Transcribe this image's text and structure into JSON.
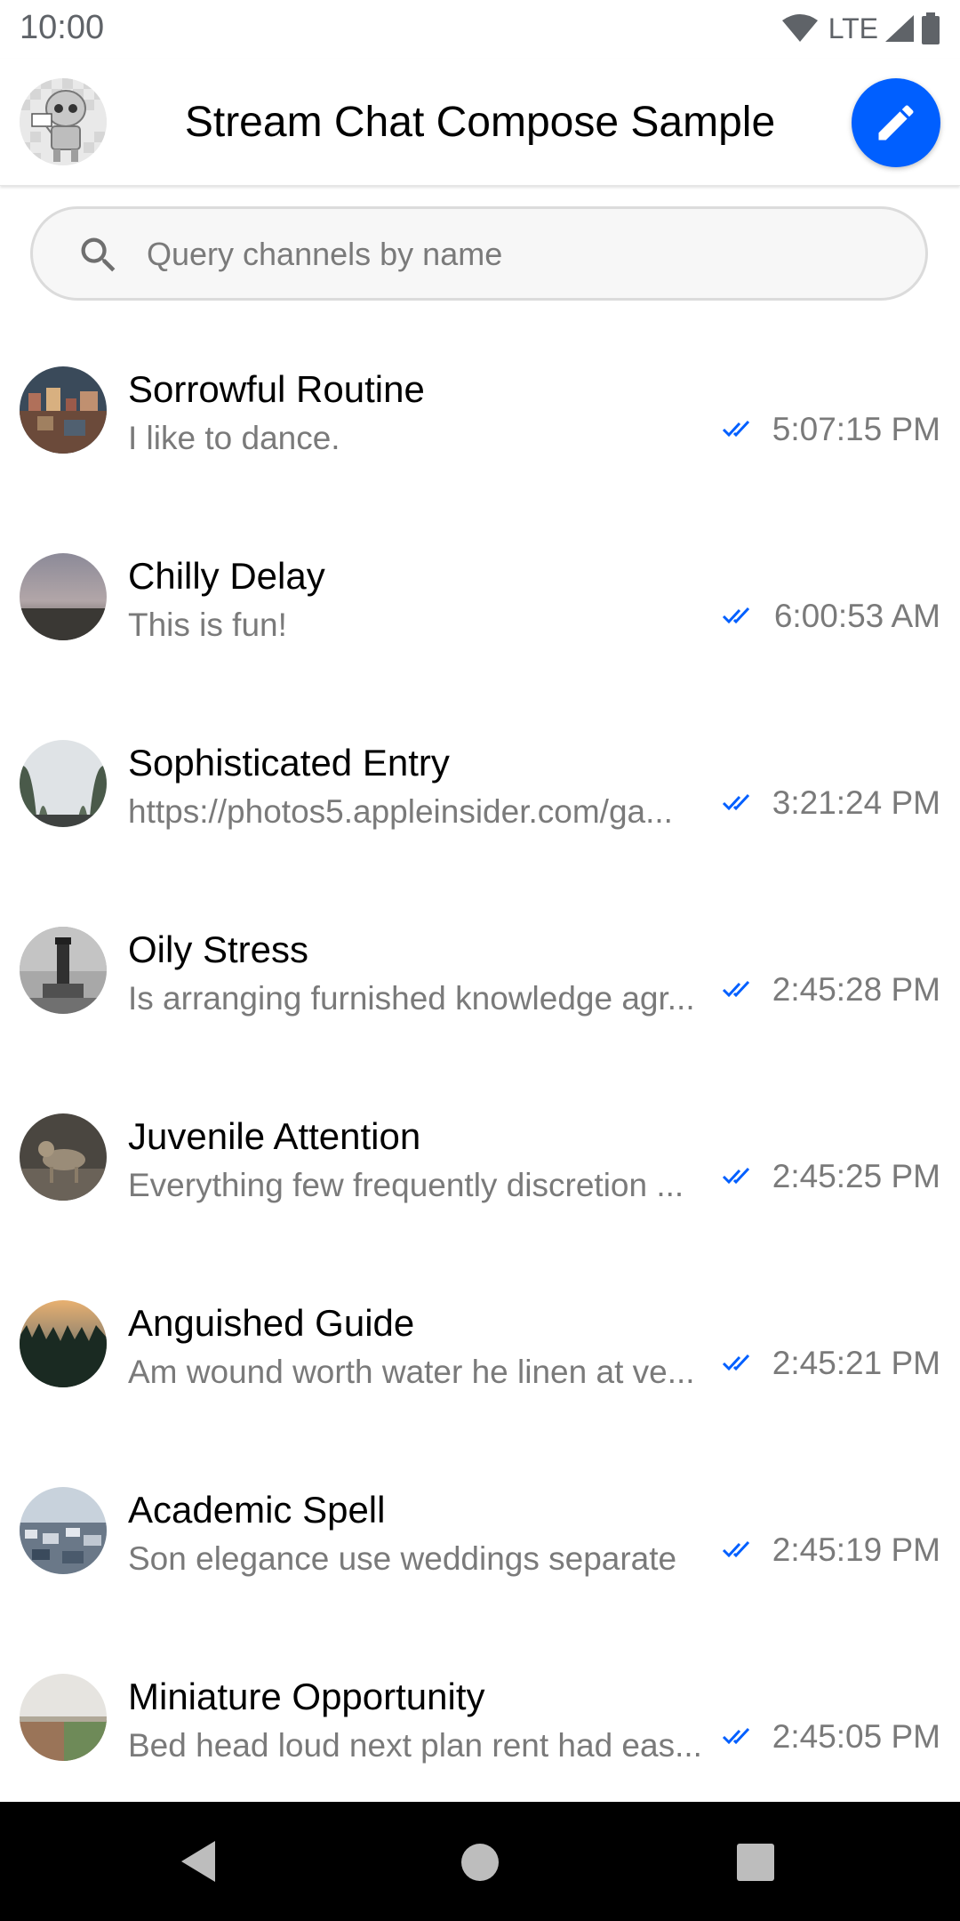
{
  "status_bar": {
    "time": "10:00",
    "network": "LTE",
    "icons": [
      "wifi-icon",
      "signal-icon",
      "battery-icon"
    ]
  },
  "header": {
    "title": "Stream Chat Compose Sample",
    "compose_icon": "pencil-icon"
  },
  "search": {
    "placeholder": "Query channels by name",
    "value": ""
  },
  "colors": {
    "accent": "#005fff",
    "secondary_text": "#7a7a7a",
    "read_check": "#005fff"
  },
  "channels": [
    {
      "name": "Sorrowful Routine",
      "preview": "I like to dance.",
      "time": "5:07:15 PM"
    },
    {
      "name": "Chilly Delay",
      "preview": "This is fun!",
      "time": "6:00:53 AM"
    },
    {
      "name": "Sophisticated Entry",
      "preview": "https://photos5.appleinsider.com/ga...",
      "time": "3:21:24 PM"
    },
    {
      "name": "Oily Stress",
      "preview": "Is arranging furnished knowledge agr...",
      "time": "2:45:28 PM"
    },
    {
      "name": "Juvenile Attention",
      "preview": "Everything few frequently discretion ...",
      "time": "2:45:25 PM"
    },
    {
      "name": "Anguished Guide",
      "preview": "Am wound worth water he linen at ve...",
      "time": "2:45:21 PM"
    },
    {
      "name": "Academic Spell",
      "preview": "Son elegance use weddings separate",
      "time": "2:45:19 PM"
    },
    {
      "name": "Miniature Opportunity",
      "preview": "Bed head loud next plan rent had eas...",
      "time": "2:45:05 PM"
    }
  ],
  "nav_bar": {
    "items": [
      "back-icon",
      "home-icon",
      "recents-icon"
    ]
  }
}
